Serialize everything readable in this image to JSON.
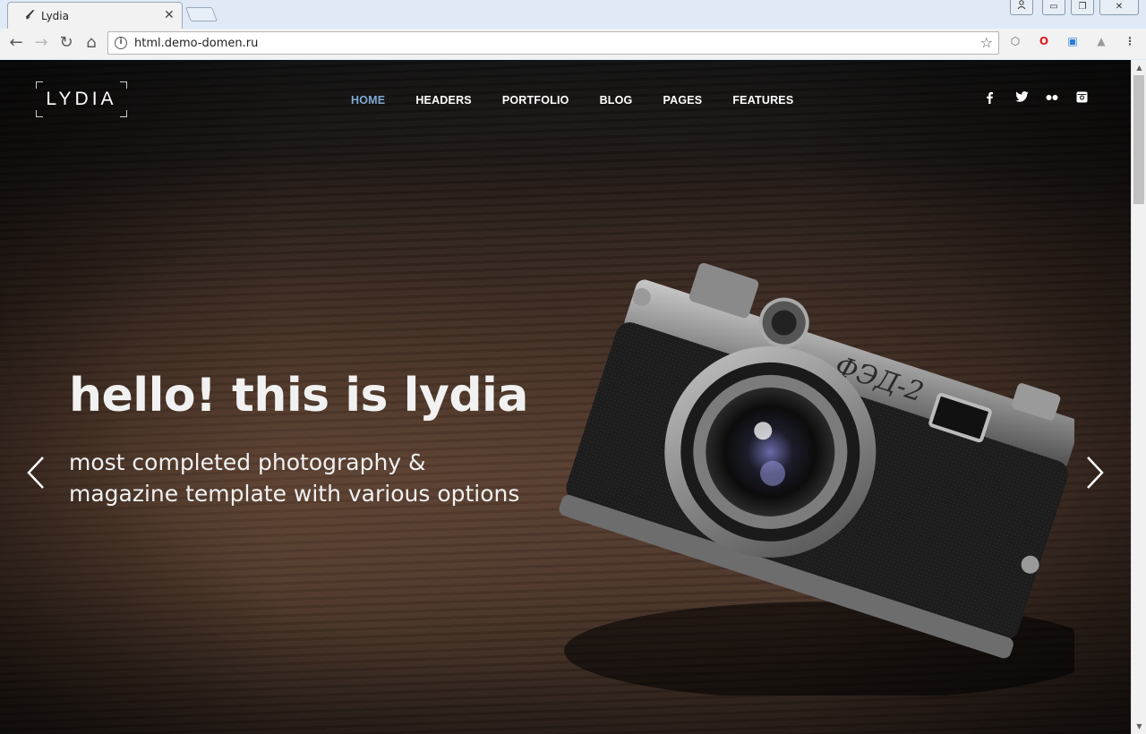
{
  "browser": {
    "tab_title": "Lydia",
    "tab_favicon": "𝓁",
    "url": "html.demo-domen.ru",
    "window_buttons": [
      "user-icon",
      "minimize-icon",
      "restore-icon",
      "close-icon"
    ]
  },
  "site": {
    "logo": "LYDIA",
    "nav": [
      "HOME",
      "HEADERS",
      "PORTFOLIO",
      "BLOG",
      "PAGES",
      "FEATURES"
    ],
    "nav_active": "HOME",
    "social": {
      "facebook": "f",
      "twitter": "🐦",
      "flickr": "••",
      "instagram": "◘"
    },
    "hero": {
      "title": "hello! this is lydia",
      "subtitle_line1": "most completed photography &",
      "subtitle_line2": "magazine template with various options"
    },
    "accent_color": "#7ea9d0"
  }
}
